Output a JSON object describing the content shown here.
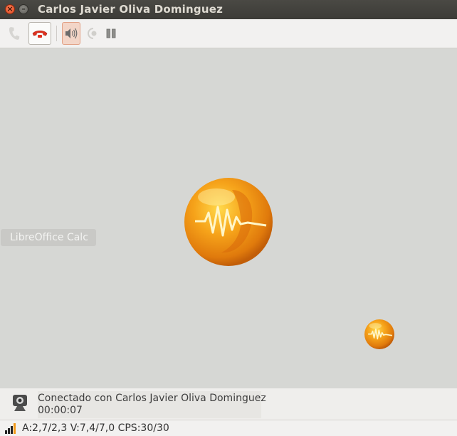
{
  "window": {
    "title": "Carlos Javier Oliva Dominguez",
    "close_glyph": "×",
    "minimize_glyph": "–"
  },
  "toolbar": {
    "buttons": [
      {
        "name": "call-icon",
        "state": "disabled"
      },
      {
        "name": "hangup-icon",
        "state": "enabled",
        "color": "#e0301e"
      },
      {
        "name": "speaker-icon",
        "state": "active"
      },
      {
        "name": "microphone-icon",
        "state": "disabled"
      },
      {
        "name": "pause-icon",
        "state": "enabled"
      }
    ]
  },
  "video": {
    "tooltip": "LibreOffice Calc",
    "remote_logo": "ekiga-logo",
    "local_preview_logo": "ekiga-logo"
  },
  "status": {
    "icon": "webcam-icon",
    "connection_text": "Conectado con Carlos Javier Oliva Dominguez",
    "duration": "00:00:07"
  },
  "footer": {
    "signal_icon": "signal-strength-icon",
    "stats": "A:2,7/2,3 V:7,4/7,0 CPS:30/30"
  },
  "colors": {
    "accent": "#e0301e",
    "logo_orange": "#f39a17",
    "titlebar": "#3c3b37"
  }
}
